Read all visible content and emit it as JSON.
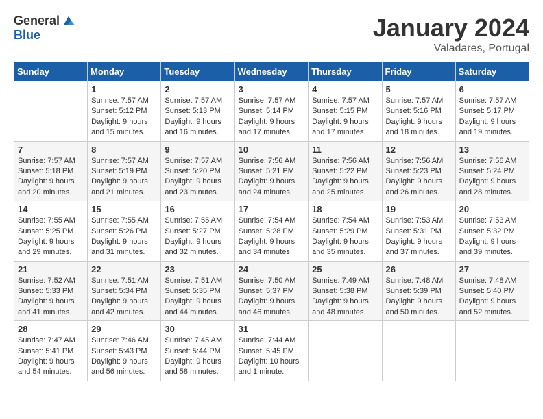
{
  "header": {
    "logo": {
      "general": "General",
      "blue": "Blue"
    },
    "title": "January 2024",
    "location": "Valadares, Portugal"
  },
  "calendar": {
    "days_of_week": [
      "Sunday",
      "Monday",
      "Tuesday",
      "Wednesday",
      "Thursday",
      "Friday",
      "Saturday"
    ],
    "weeks": [
      [
        {
          "day": "",
          "info": ""
        },
        {
          "day": "1",
          "info": "Sunrise: 7:57 AM\nSunset: 5:12 PM\nDaylight: 9 hours\nand 15 minutes."
        },
        {
          "day": "2",
          "info": "Sunrise: 7:57 AM\nSunset: 5:13 PM\nDaylight: 9 hours\nand 16 minutes."
        },
        {
          "day": "3",
          "info": "Sunrise: 7:57 AM\nSunset: 5:14 PM\nDaylight: 9 hours\nand 17 minutes."
        },
        {
          "day": "4",
          "info": "Sunrise: 7:57 AM\nSunset: 5:15 PM\nDaylight: 9 hours\nand 17 minutes."
        },
        {
          "day": "5",
          "info": "Sunrise: 7:57 AM\nSunset: 5:16 PM\nDaylight: 9 hours\nand 18 minutes."
        },
        {
          "day": "6",
          "info": "Sunrise: 7:57 AM\nSunset: 5:17 PM\nDaylight: 9 hours\nand 19 minutes."
        }
      ],
      [
        {
          "day": "7",
          "info": "Sunrise: 7:57 AM\nSunset: 5:18 PM\nDaylight: 9 hours\nand 20 minutes."
        },
        {
          "day": "8",
          "info": "Sunrise: 7:57 AM\nSunset: 5:19 PM\nDaylight: 9 hours\nand 21 minutes."
        },
        {
          "day": "9",
          "info": "Sunrise: 7:57 AM\nSunset: 5:20 PM\nDaylight: 9 hours\nand 23 minutes."
        },
        {
          "day": "10",
          "info": "Sunrise: 7:56 AM\nSunset: 5:21 PM\nDaylight: 9 hours\nand 24 minutes."
        },
        {
          "day": "11",
          "info": "Sunrise: 7:56 AM\nSunset: 5:22 PM\nDaylight: 9 hours\nand 25 minutes."
        },
        {
          "day": "12",
          "info": "Sunrise: 7:56 AM\nSunset: 5:23 PM\nDaylight: 9 hours\nand 26 minutes."
        },
        {
          "day": "13",
          "info": "Sunrise: 7:56 AM\nSunset: 5:24 PM\nDaylight: 9 hours\nand 28 minutes."
        }
      ],
      [
        {
          "day": "14",
          "info": "Sunrise: 7:55 AM\nSunset: 5:25 PM\nDaylight: 9 hours\nand 29 minutes."
        },
        {
          "day": "15",
          "info": "Sunrise: 7:55 AM\nSunset: 5:26 PM\nDaylight: 9 hours\nand 31 minutes."
        },
        {
          "day": "16",
          "info": "Sunrise: 7:55 AM\nSunset: 5:27 PM\nDaylight: 9 hours\nand 32 minutes."
        },
        {
          "day": "17",
          "info": "Sunrise: 7:54 AM\nSunset: 5:28 PM\nDaylight: 9 hours\nand 34 minutes."
        },
        {
          "day": "18",
          "info": "Sunrise: 7:54 AM\nSunset: 5:29 PM\nDaylight: 9 hours\nand 35 minutes."
        },
        {
          "day": "19",
          "info": "Sunrise: 7:53 AM\nSunset: 5:31 PM\nDaylight: 9 hours\nand 37 minutes."
        },
        {
          "day": "20",
          "info": "Sunrise: 7:53 AM\nSunset: 5:32 PM\nDaylight: 9 hours\nand 39 minutes."
        }
      ],
      [
        {
          "day": "21",
          "info": "Sunrise: 7:52 AM\nSunset: 5:33 PM\nDaylight: 9 hours\nand 41 minutes."
        },
        {
          "day": "22",
          "info": "Sunrise: 7:51 AM\nSunset: 5:34 PM\nDaylight: 9 hours\nand 42 minutes."
        },
        {
          "day": "23",
          "info": "Sunrise: 7:51 AM\nSunset: 5:35 PM\nDaylight: 9 hours\nand 44 minutes."
        },
        {
          "day": "24",
          "info": "Sunrise: 7:50 AM\nSunset: 5:37 PM\nDaylight: 9 hours\nand 46 minutes."
        },
        {
          "day": "25",
          "info": "Sunrise: 7:49 AM\nSunset: 5:38 PM\nDaylight: 9 hours\nand 48 minutes."
        },
        {
          "day": "26",
          "info": "Sunrise: 7:48 AM\nSunset: 5:39 PM\nDaylight: 9 hours\nand 50 minutes."
        },
        {
          "day": "27",
          "info": "Sunrise: 7:48 AM\nSunset: 5:40 PM\nDaylight: 9 hours\nand 52 minutes."
        }
      ],
      [
        {
          "day": "28",
          "info": "Sunrise: 7:47 AM\nSunset: 5:41 PM\nDaylight: 9 hours\nand 54 minutes."
        },
        {
          "day": "29",
          "info": "Sunrise: 7:46 AM\nSunset: 5:43 PM\nDaylight: 9 hours\nand 56 minutes."
        },
        {
          "day": "30",
          "info": "Sunrise: 7:45 AM\nSunset: 5:44 PM\nDaylight: 9 hours\nand 58 minutes."
        },
        {
          "day": "31",
          "info": "Sunrise: 7:44 AM\nSunset: 5:45 PM\nDaylight: 10 hours\nand 1 minute."
        },
        {
          "day": "",
          "info": ""
        },
        {
          "day": "",
          "info": ""
        },
        {
          "day": "",
          "info": ""
        }
      ]
    ]
  }
}
